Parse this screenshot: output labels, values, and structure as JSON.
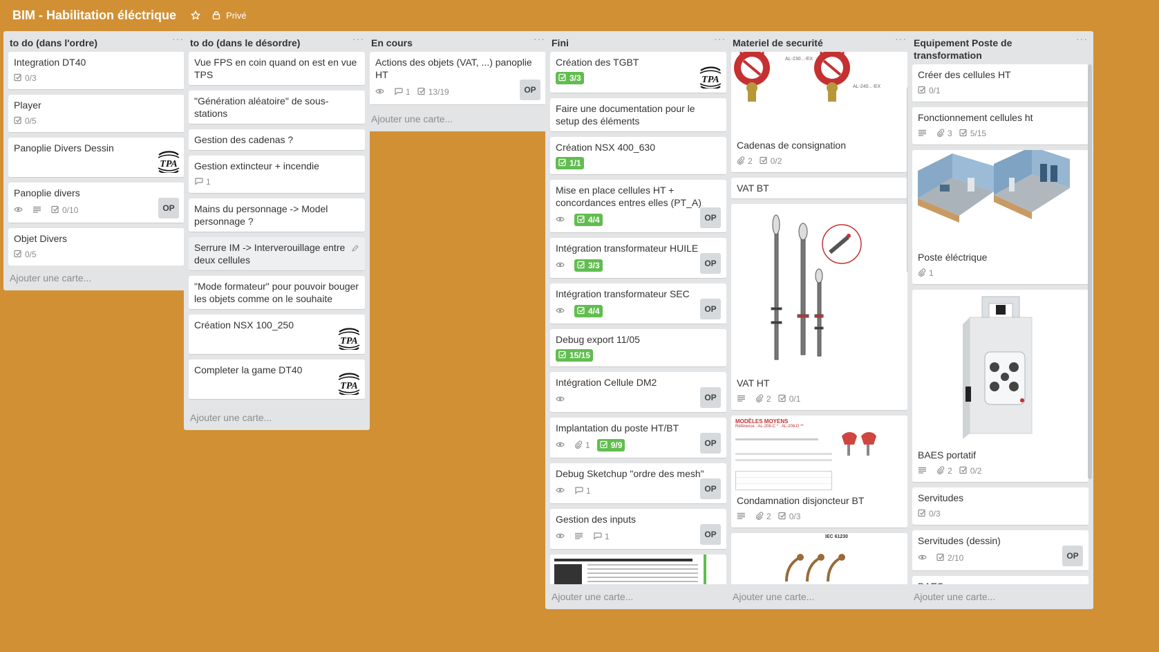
{
  "board": {
    "title": "BIM - Habilitation éléctrique",
    "visibility": "Privé"
  },
  "add_card_label": "Ajouter une carte...",
  "lists": [
    {
      "title": "to do (dans l'ordre)",
      "cards": [
        {
          "title": "Integration DT40",
          "checklist": "0/3"
        },
        {
          "title": "Player",
          "checklist": "0/5"
        },
        {
          "title": "Panoplie Divers Dessin",
          "logo": true
        },
        {
          "title": "Panoplie divers",
          "checklist": "0/10",
          "watch": true,
          "desc": true,
          "member": "OP"
        },
        {
          "title": "Objet Divers",
          "checklist": "0/5"
        }
      ]
    },
    {
      "title": "to do (dans le désordre)",
      "cards": [
        {
          "title": "Vue FPS en coin quand on est en vue TPS"
        },
        {
          "title": "\"Génération aléatoire\" de sous-stations"
        },
        {
          "title": "Gestion des cadenas ?"
        },
        {
          "title": "Gestion extincteur + incendie",
          "comments": "1"
        },
        {
          "title": "Mains du personnage -> Model personnage ?"
        },
        {
          "title": "Serrure IM -> Interverouillage entre deux cellules",
          "hover": true
        },
        {
          "title": "\"Mode formateur\" pour pouvoir bouger les objets comme on le souhaite"
        },
        {
          "title": "Création NSX 100_250",
          "logo": true
        },
        {
          "title": "Completer la game DT40",
          "logo": true
        }
      ]
    },
    {
      "title": "En cours",
      "cards": [
        {
          "title": "Actions des objets (VAT, ...) panoplie HT",
          "watch": true,
          "comments": "1",
          "checklist": "13/19",
          "member": "OP"
        }
      ]
    },
    {
      "title": "Fini",
      "cards": [
        {
          "title": "Création des TGBT",
          "checklist_done": "3/3",
          "logo": true
        },
        {
          "title": "Faire une documentation pour le setup des éléments"
        },
        {
          "title": "Création NSX 400_630",
          "checklist_done": "1/1"
        },
        {
          "title": "Mise en place cellules HT + concordances entres elles (PT_A)",
          "watch": true,
          "checklist_done": "4/4",
          "member": "OP"
        },
        {
          "title": "Intégration transformateur HUILE",
          "watch": true,
          "checklist_done": "3/3",
          "member": "OP"
        },
        {
          "title": "Intégration transformateur SEC",
          "watch": true,
          "checklist_done": "4/4",
          "member": "OP"
        },
        {
          "title": "Debug export 11/05",
          "checklist_done": "15/15"
        },
        {
          "title": "Intégration Cellule DM2",
          "watch": true,
          "member": "OP"
        },
        {
          "title": "Implantation du poste HT/BT",
          "watch": true,
          "attachments": "1",
          "checklist_done": "9/9",
          "member": "OP"
        },
        {
          "title": "Debug Sketchup \"ordre des mesh\"",
          "watch": true,
          "comments": "1",
          "member": "OP"
        },
        {
          "title": "Gestion des inputs",
          "watch": true,
          "desc": true,
          "comments": "1",
          "member": "OP"
        }
      ]
    },
    {
      "title": "Materiel de securité",
      "cards": [
        {
          "title": "Cadenas de consignation",
          "attachments": "2",
          "checklist": "0/2",
          "cover": "padlocks"
        },
        {
          "title": "VAT BT"
        },
        {
          "title": "VAT HT",
          "desc": true,
          "attachments": "2",
          "checklist": "0/1",
          "cover": "vat"
        },
        {
          "title": "Condamnation disjoncteur BT",
          "desc": true,
          "attachments": "2",
          "checklist": "0/3",
          "cover": "doc"
        }
      ],
      "cover_texts": {
        "padlock_left": "AL-230...-EX",
        "padlock_right": "AL-240...-EX",
        "doc_heading": "MODÈLES MOYENS",
        "doc_ref": "Référence : AL-208-C * ; AL-208-D **",
        "iec": "IEC 61230"
      }
    },
    {
      "title": "Equipement Poste de transformation",
      "cards": [
        {
          "title": "Créer des cellules HT",
          "checklist": "0/1"
        },
        {
          "title": "Fonctionnement cellules ht",
          "desc": true,
          "attachments": "3",
          "checklist": "5/15"
        },
        {
          "title": "Poste éléctrique",
          "attachments": "1",
          "cover": "rooms"
        },
        {
          "title": "BAES portatif",
          "desc": true,
          "attachments": "2",
          "checklist": "0/2",
          "cover": "baes"
        },
        {
          "title": "Servitudes",
          "checklist": "0/3"
        },
        {
          "title": "Servitudes (dessin)",
          "watch": true,
          "checklist": "2/10",
          "member": "OP"
        },
        {
          "title": "BAES"
        }
      ]
    }
  ]
}
